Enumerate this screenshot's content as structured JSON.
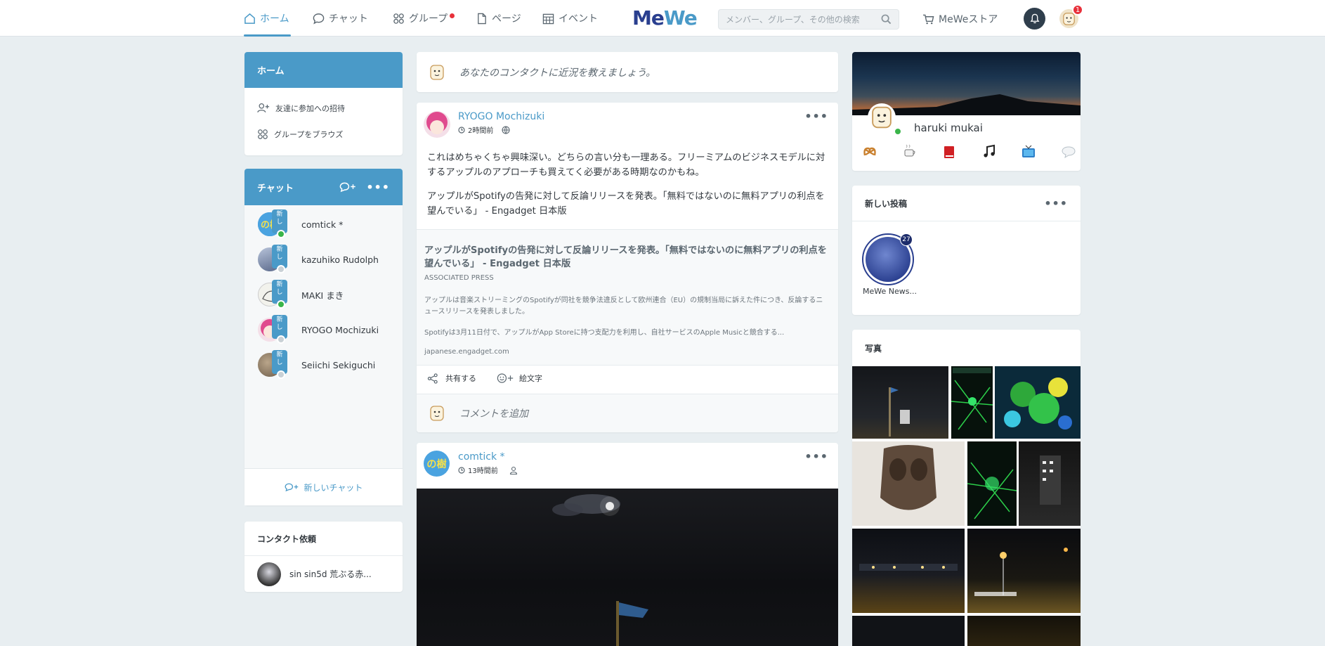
{
  "topnav": {
    "items": [
      {
        "label": "ホーム",
        "icon": "home-icon",
        "active": true
      },
      {
        "label": "チャット",
        "icon": "chat-icon"
      },
      {
        "label": "グループ",
        "icon": "groups-icon",
        "dot": true
      },
      {
        "label": "ページ",
        "icon": "page-icon"
      },
      {
        "label": "イベント",
        "icon": "calendar-icon"
      }
    ],
    "logo": "MeWe",
    "search_placeholder": "メンバー、グループ、その他の検索",
    "store_label": "MeWeストア",
    "notification_count": "1"
  },
  "left": {
    "home_title": "ホーム",
    "invite_label": "友達に参加への招待",
    "browse_label": "グループをブラウズ",
    "chat_title": "チャット",
    "chats": [
      {
        "name": "comtick *",
        "status": "online"
      },
      {
        "name": "kazuhiko Rudolph",
        "status": "offline"
      },
      {
        "name": "MAKI まき",
        "status": "online"
      },
      {
        "name": "RYOGO Mochizuki",
        "status": "offline"
      },
      {
        "name": "Seiichi Sekiguchi",
        "status": "offline"
      }
    ],
    "new_tag": "新し",
    "new_chat_label": "新しいチャット",
    "contact_requests_title": "コンタクト依頼",
    "contact_request_name": "sin sin5d 荒ぶる赤..."
  },
  "composer": {
    "placeholder": "あなたのコンタクトに近況を教えましょう。"
  },
  "post1": {
    "author": "RYOGO Mochizuki",
    "time": "2時間前",
    "text1": "これはめちゃくちゃ興味深い。どちらの言い分も一理ある。フリーミアムのビジネスモデルに対するアップルのアプローチも買えてく必要がある時期なのかもね。",
    "text2": "アップルがSpotifyの告発に対して反論リリースを発表。「無料ではないのに無料アプリの利点を望んでいる」 - Engadget 日本版",
    "link_title": "アップルがSpotifyの告発に対して反論リリースを発表。「無料ではないのに無料アプリの利点を望んでいる」 - Engadget 日本版",
    "link_source": "ASSOCIATED PRESS",
    "link_desc1": "アップルは音楽ストリーミングのSpotifyが同社を競争法違反として欧州連合（EU）の規制当局に訴えた件につき、反論するニュースリリースを発表しました。",
    "link_desc2": "Spotifyは3月11日付で、アップルがApp Storeに持つ支配力を利用し、自社サービスのApple Musicと競合する...",
    "link_domain": "japanese.engadget.com",
    "share_label": "共有する",
    "emoji_label": "絵文字",
    "comment_placeholder": "コメントを追加"
  },
  "post2": {
    "author": "comtick *",
    "time": "13時間前"
  },
  "profile": {
    "name": "haruki mukai",
    "app_icons": [
      "pretzel-icon",
      "coffee-icon",
      "book-icon",
      "music-note-icon",
      "tv-icon",
      "speech-bubble-icon"
    ]
  },
  "new_posts": {
    "title": "新しい投稿",
    "item_label": "MeWe News...",
    "item_count": "27"
  },
  "photos": {
    "title": "写真"
  },
  "colors": {
    "accent": "#4a9ac8",
    "notification": "#e8303a",
    "online": "#3ab54a"
  }
}
